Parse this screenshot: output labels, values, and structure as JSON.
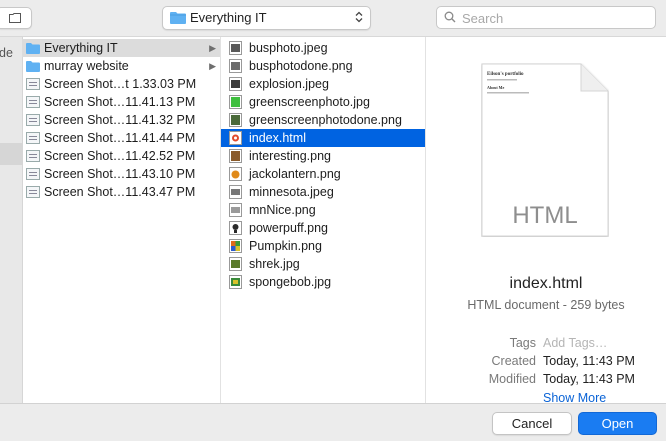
{
  "toolbar": {
    "location_label": "Everything IT",
    "search_placeholder": "Search"
  },
  "sidebar": {
    "partial_label": "de"
  },
  "column1": {
    "items": [
      {
        "label": "Everything IT",
        "icon": "folder-icon",
        "has_arrow": true,
        "selected": true
      },
      {
        "label": "murray website",
        "icon": "folder-icon",
        "has_arrow": true,
        "selected": false
      },
      {
        "label": "Screen Shot…t 1.33.03 PM",
        "icon": "screenshot-file-icon",
        "has_arrow": false,
        "selected": false
      },
      {
        "label": "Screen Shot…11.41.13 PM",
        "icon": "screenshot-file-icon",
        "has_arrow": false,
        "selected": false
      },
      {
        "label": "Screen Shot…11.41.32 PM",
        "icon": "screenshot-file-icon",
        "has_arrow": false,
        "selected": false
      },
      {
        "label": "Screen Shot…11.41.44 PM",
        "icon": "screenshot-file-icon",
        "has_arrow": false,
        "selected": false
      },
      {
        "label": "Screen Shot…11.42.52 PM",
        "icon": "screenshot-file-icon",
        "has_arrow": false,
        "selected": false
      },
      {
        "label": "Screen Shot…11.43.10 PM",
        "icon": "screenshot-file-icon",
        "has_arrow": false,
        "selected": false
      },
      {
        "label": "Screen Shot…11.43.47 PM",
        "icon": "screenshot-file-icon",
        "has_arrow": false,
        "selected": false
      }
    ]
  },
  "column2": {
    "items": [
      {
        "label": "busphoto.jpeg",
        "thumb_color": "#5a5a5a",
        "selected": false
      },
      {
        "label": "busphotodone.png",
        "thumb_color": "#6b6b6b",
        "selected": false
      },
      {
        "label": "explosion.jpeg",
        "thumb_color": "#3b3b3b",
        "selected": false
      },
      {
        "label": "greenscreenphoto.jpg",
        "thumb_color": "#3fbf3f",
        "selected": false
      },
      {
        "label": "greenscreenphotodone.png",
        "thumb_color": "#4a6a3a",
        "selected": false
      },
      {
        "label": "index.html",
        "thumb_color": "#e24a2a",
        "selected": true
      },
      {
        "label": "interesting.png",
        "thumb_color": "#8a5a2a",
        "selected": false
      },
      {
        "label": "jackolantern.png",
        "thumb_color": "#e08a1a",
        "selected": false
      },
      {
        "label": "minnesota.jpeg",
        "thumb_color": "#777777",
        "selected": false
      },
      {
        "label": "mnNice.png",
        "thumb_color": "#9a9a9a",
        "selected": false
      },
      {
        "label": "powerpuff.png",
        "thumb_color": "#2a2a2a",
        "selected": false
      },
      {
        "label": "Pumpkin.png",
        "thumb_color": "#e06a1a",
        "selected": false
      },
      {
        "label": "shrek.jpg",
        "thumb_color": "#5a7a2a",
        "selected": false
      },
      {
        "label": "spongebob.jpg",
        "thumb_color": "#d8c22a",
        "selected": false
      }
    ]
  },
  "preview": {
    "thumb_label": "HTML",
    "thumb_heading": "Eilson's portfolio",
    "thumb_subheading": "About Me",
    "name": "index.html",
    "kind": "HTML document - 259 bytes",
    "tags_label": "Tags",
    "tags_placeholder": "Add Tags…",
    "created_label": "Created",
    "created_value": "Today, 11:43 PM",
    "modified_label": "Modified",
    "modified_value": "Today, 11:43 PM",
    "show_more": "Show More"
  },
  "footer": {
    "cancel_label": "Cancel",
    "open_label": "Open"
  },
  "colors": {
    "selection_blue": "#0063e1",
    "open_button": "#1a7cf2",
    "folder_blue": "#5fb1f2"
  }
}
